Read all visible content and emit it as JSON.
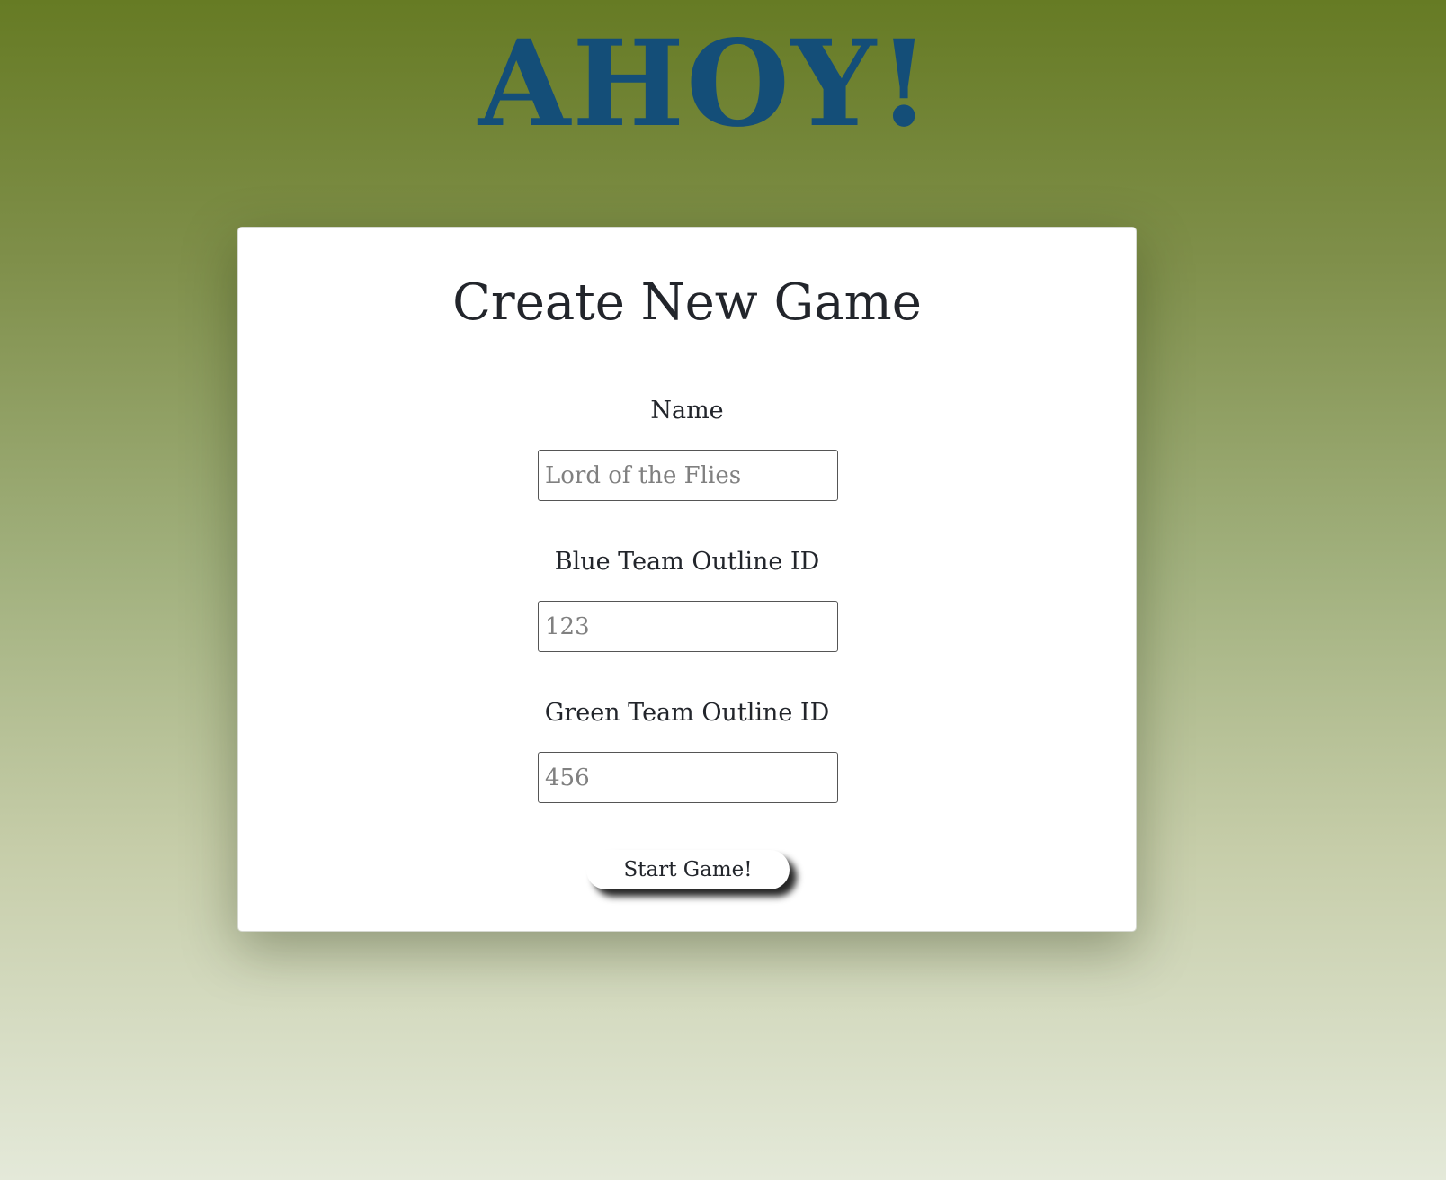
{
  "header": {
    "logo_text": "AHOY!"
  },
  "form": {
    "title": "Create New Game",
    "fields": [
      {
        "label": "Name",
        "placeholder": "Lord of the Flies",
        "value": ""
      },
      {
        "label": "Blue Team Outline ID",
        "placeholder": "123",
        "value": ""
      },
      {
        "label": "Green Team Outline ID",
        "placeholder": "456",
        "value": ""
      }
    ],
    "submit_label": "Start Game!"
  },
  "colors": {
    "logo": "#144e78",
    "background_top": "#667b24",
    "background_bottom": "#e4e9d9",
    "card": "#ffffff",
    "text": "#22252b"
  }
}
